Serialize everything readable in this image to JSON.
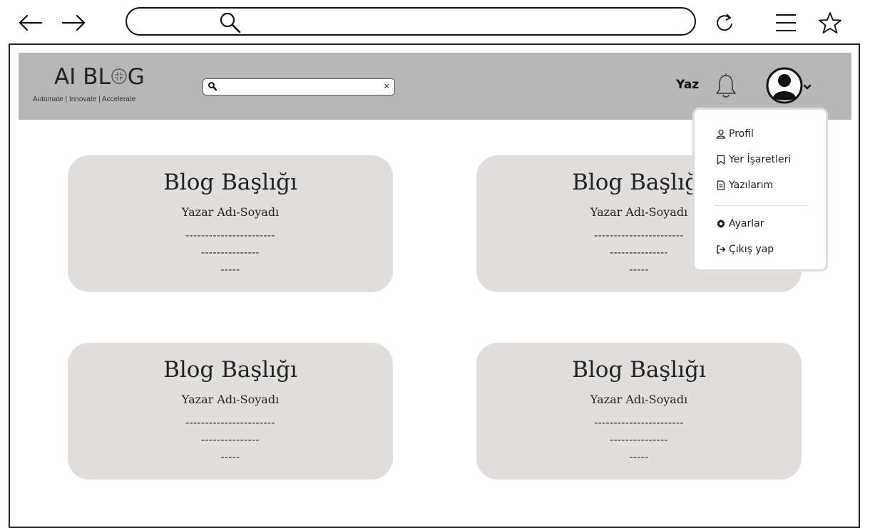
{
  "browser": {
    "icons": {
      "back": "arrow-left-icon",
      "forward": "arrow-right-icon",
      "search": "search-icon",
      "reload": "reload-icon",
      "menu": "hamburger-icon",
      "bookmark": "star-icon"
    }
  },
  "header": {
    "logo_title_a": "AI BL",
    "logo_title_b": "G",
    "logo_tagline": "Automate | Innovate | Accelerate",
    "search_value": "",
    "clear_symbol": "×",
    "write_label": "Yaz",
    "bg_color": "#b7b7b7"
  },
  "cards": [
    {
      "title": "Blog Başlığı",
      "author": "Yazar Adı-Soyadı",
      "line1": "-----------------------",
      "line2": "---------------",
      "line3": "-----"
    },
    {
      "title": "Blog Başlığı",
      "author": "Yazar Adı-Soyadı",
      "line1": "-----------------------",
      "line2": "---------------",
      "line3": "-----"
    },
    {
      "title": "Blog Başlığı",
      "author": "Yazar Adı-Soyadı",
      "line1": "-----------------------",
      "line2": "---------------",
      "line3": "-----"
    },
    {
      "title": "Blog Başlığı",
      "author": "Yazar Adı-Soyadı",
      "line1": "-----------------------",
      "line2": "---------------",
      "line3": "-----"
    }
  ],
  "user_menu": {
    "items": [
      {
        "label": "Profil",
        "icon": "user-icon"
      },
      {
        "label": "Yer İşaretleri",
        "icon": "bookmark-icon"
      },
      {
        "label": "Yazılarım",
        "icon": "document-icon"
      },
      {
        "label": "Ayarlar",
        "icon": "gear-icon"
      },
      {
        "label": "Çıkış yap",
        "icon": "logout-icon"
      }
    ]
  },
  "colors": {
    "card_bg": "#e1dfde",
    "header_bg": "#b7b7b7"
  }
}
